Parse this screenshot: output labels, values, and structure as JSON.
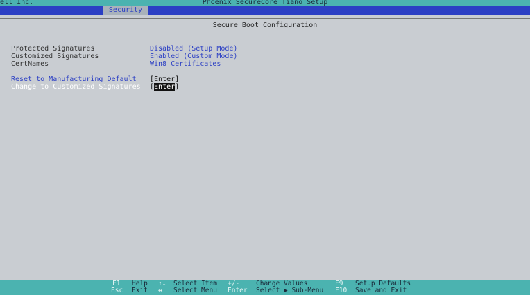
{
  "header": {
    "vendor": "ell Inc.",
    "title": "Phoenix SecureCore Tiano Setup"
  },
  "tabs": [
    {
      "label": "Security"
    }
  ],
  "section_title": "Secure Boot Configuration",
  "settings": [
    {
      "label": "Protected Signatures",
      "value": "Disabled (Setup Mode)"
    },
    {
      "label": "Customized Signatures",
      "value": "Enabled (Custom Mode)"
    },
    {
      "label": "CertNames",
      "value": "Win8 Certificates"
    }
  ],
  "actions": [
    {
      "label": "Reset to Manufacturing Default",
      "value": "[Enter]"
    },
    {
      "label": "Change to Customized Signatures",
      "value_open": "[",
      "value_key": "Enter",
      "value_close": "]"
    }
  ],
  "footer": [
    {
      "key": "F1",
      "desc": "Help"
    },
    {
      "key": "↑↓",
      "desc": "Select Item"
    },
    {
      "key": "+/-",
      "desc": "Change Values"
    },
    {
      "key": "F9",
      "desc": "Setup Defaults"
    },
    {
      "key": "Esc",
      "desc": "Exit"
    },
    {
      "key": "↔",
      "desc": "Select Menu"
    },
    {
      "key": "Enter",
      "desc": "Select ▶ Sub-Menu"
    },
    {
      "key": "F10",
      "desc": "Save and Exit"
    }
  ]
}
